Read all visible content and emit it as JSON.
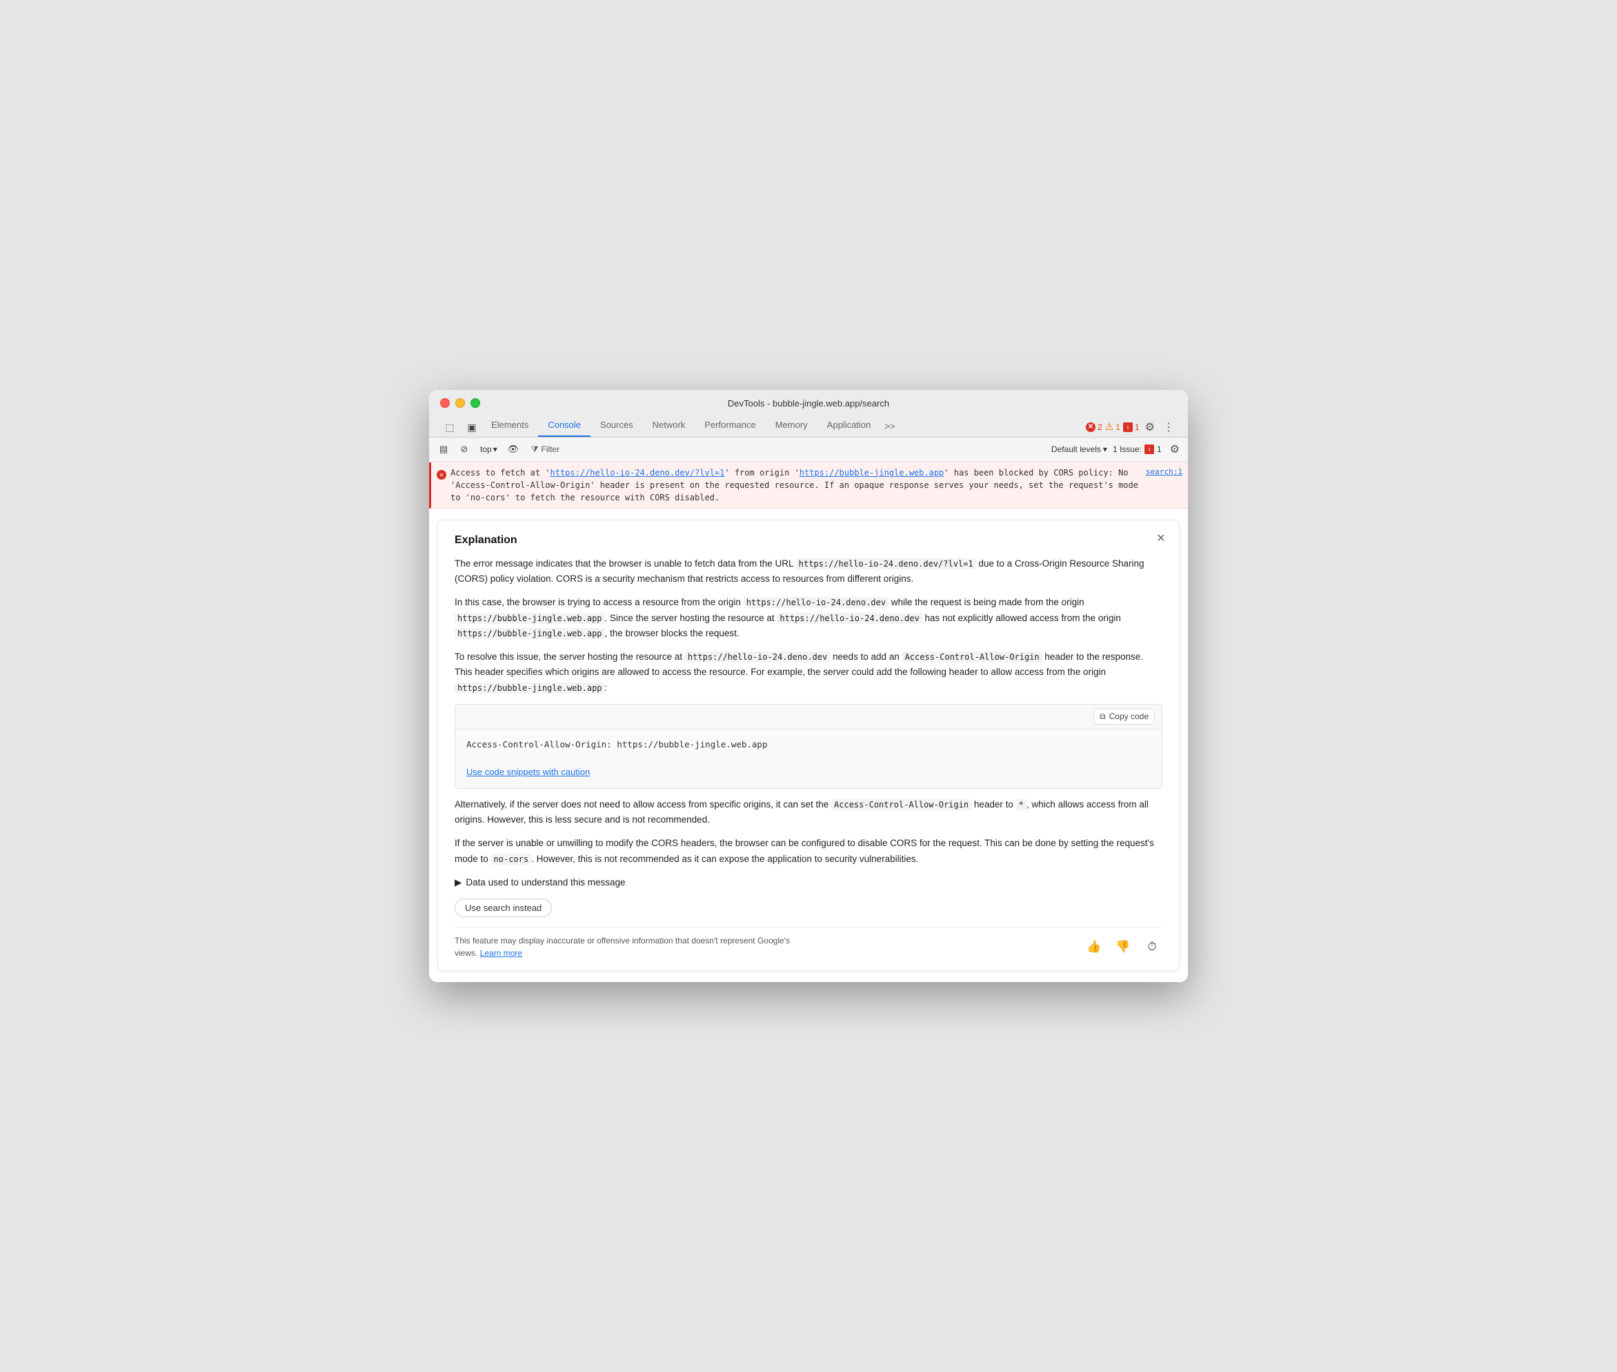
{
  "window": {
    "title": "DevTools - bubble-jingle.web.app/search"
  },
  "tabs": {
    "items": [
      {
        "label": "Elements",
        "active": false
      },
      {
        "label": "Console",
        "active": true
      },
      {
        "label": "Sources",
        "active": false
      },
      {
        "label": "Network",
        "active": false
      },
      {
        "label": "Performance",
        "active": false
      },
      {
        "label": "Memory",
        "active": false
      },
      {
        "label": "Application",
        "active": false
      }
    ],
    "more": ">>"
  },
  "toolbar_right": {
    "errors_count": "2",
    "warnings_count": "1",
    "info_count": "1"
  },
  "secondary_toolbar": {
    "top_label": "top",
    "filter_label": "Filter",
    "default_levels": "Default levels",
    "issues_label": "1 Issue:",
    "issues_count": "1"
  },
  "error_message": {
    "text_before": "Access to fetch at '",
    "url1": "https://hello-io-24.deno.dev/?lvl=1",
    "text_middle": "' from origin '",
    "url2": "https://bubble-jingle.web.app",
    "text_after": "' has been blocked by CORS policy: No 'Access-Control-Allow-Origin' header is present on the requested resource. If an opaque response serves your needs, set the request's mode to 'no-cors' to fetch the resource with CORS disabled.",
    "source": "search:1"
  },
  "explanation": {
    "title": "Explanation",
    "para1": "The error message indicates that the browser is unable to fetch data from the URL https://hello-io-24.deno.dev/?lvl=1 due to a Cross-Origin Resource Sharing (CORS) policy violation. CORS is a security mechanism that restricts access to resources from different origins.",
    "para1_code": "https://hello-io-24.deno.dev/?lvl=1",
    "para2_pre": "In this case, the browser is trying to access a resource from the origin ",
    "para2_code1": "https://hello-io-24.deno.dev",
    "para2_mid1": " while the request is being made from the origin ",
    "para2_code2": "https://bubble-jingle.web.app",
    "para2_mid2": ". Since the server hosting the resource at ",
    "para2_code3": "https://hello-io-24.deno.dev",
    "para2_mid3": " has not explicitly allowed access from the origin ",
    "para2_code4": "https://bubble-jingle.web.app",
    "para2_end": ", the browser blocks the request.",
    "para3_pre": "To resolve this issue, the server hosting the resource at ",
    "para3_code1": "https://hello-io-24.deno.dev",
    "para3_mid": " needs to add an ",
    "para3_code2": "Access-Control-Allow-Origin",
    "para3_mid2": " header to the response. This header specifies which origins are allowed to access the resource. For example, the server could add the following header to allow access from the origin ",
    "para3_code3": "https://bubble-jingle.web.app",
    "para3_end": ":",
    "copy_code_label": "Copy code",
    "code_snippet": "Access-Control-Allow-Origin: https://bubble-jingle.web.app",
    "caution_link": "Use code snippets with caution",
    "para4_pre": "Alternatively, if the server does not need to allow access from specific origins, it can set the ",
    "para4_code1": "Access-Control-Allow-Origin",
    "para4_mid": " header to ",
    "para4_code2": "*",
    "para4_end": ", which allows access from all origins. However, this is less secure and is not recommended.",
    "para5": "If the server is unable or unwilling to modify the CORS headers, the browser can be configured to disable CORS for the request. This can be done by setting the request's mode to no-cors. However, this is not recommended as it can expose the application to security vulnerabilities.",
    "para5_code": "no-cors",
    "data_used_label": "Data used to understand this message",
    "use_search_label": "Use search instead",
    "disclaimer": "This feature may display inaccurate or offensive information that doesn't represent Google's views.",
    "learn_more": "Learn more"
  }
}
